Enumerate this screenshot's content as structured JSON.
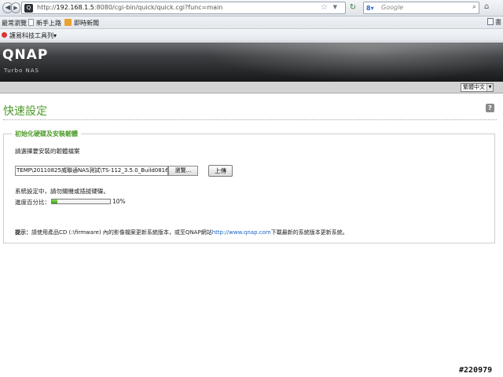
{
  "browser": {
    "url_protocol": "http://",
    "url_host": "192.168.1.5",
    "url_path": ":8080/cgi-bin/quick/quick.cgi?func=main",
    "search_placeholder": "Google",
    "bookmarks": [
      "最常瀏覽",
      "新手上路",
      "即時新聞"
    ],
    "bookmarks_right": "書",
    "toolbar_item": "護易科技工具列"
  },
  "header": {
    "logo": "QNAP",
    "tagline": "Turbo NAS"
  },
  "language": {
    "selected": "繁體中文"
  },
  "page": {
    "title": "快速設定",
    "help_icon_label": "?"
  },
  "panel": {
    "legend": "初始化硬碟及安裝韌體",
    "instruction": "請選擇要安裝的韌體檔案",
    "file_value": "TEMP\\20110825威聯通NAS測試\\TS-112_3.5.0_Build0816.img",
    "browse_label": "瀏覽...",
    "upload_label": "上傳",
    "status_text": "系統設定中，請勿關機或插拔硬碟。",
    "progress_label": "進度百分比：",
    "progress_percent": 10,
    "progress_text": "10%",
    "hint_label": "提示：",
    "hint_text": "請使用產品CD (:\\firmware) 內的影像檔案更新系統版本，或至QNAP網站",
    "hint_link": "http://www.qnap.com",
    "hint_tail": "下載最新的系統版本更新系統。"
  },
  "watermark": "#220979"
}
